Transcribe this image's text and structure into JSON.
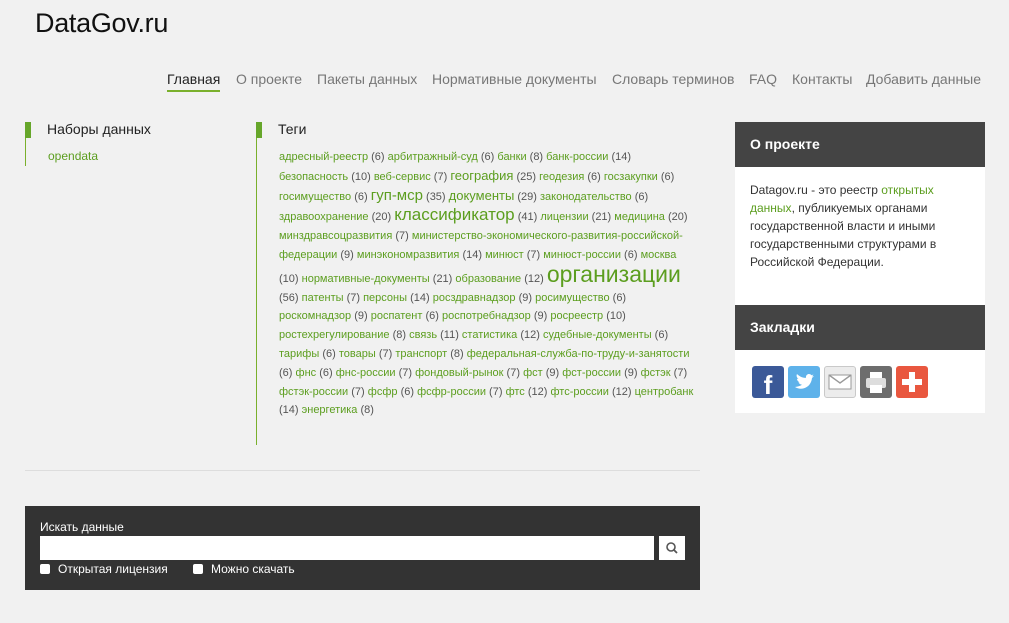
{
  "site": {
    "title": "DataGov.ru"
  },
  "nav": [
    "Главная",
    "О проекте",
    "Пакеты данных",
    "Нормативные документы",
    "Словарь терминов",
    "FAQ",
    "Контакты",
    "Добавить данные"
  ],
  "datasets": {
    "heading": "Наборы данных",
    "items": [
      "opendata"
    ]
  },
  "tags": {
    "heading": "Теги",
    "items": [
      {
        "name": "адресный-реестр",
        "count": "(6)"
      },
      {
        "name": "арбитражный-суд",
        "count": "(6)"
      },
      {
        "name": "банки",
        "count": "(8)"
      },
      {
        "name": "банк-россии",
        "count": "(14)"
      },
      {
        "name": "безопасность",
        "count": "(10)"
      },
      {
        "name": "веб-сервис",
        "count": "(7)"
      },
      {
        "name": "география",
        "count": "(25)"
      },
      {
        "name": "геодезия",
        "count": "(6)"
      },
      {
        "name": "госзакупки",
        "count": "(6)"
      },
      {
        "name": "госимущество",
        "count": "(6)"
      },
      {
        "name": "гуп-мср",
        "count": "(35)"
      },
      {
        "name": "документы",
        "count": "(29)"
      },
      {
        "name": "законодательство",
        "count": "(6)"
      },
      {
        "name": "здравоохранение",
        "count": "(20)"
      },
      {
        "name": "классификатор",
        "count": "(41)"
      },
      {
        "name": "лицензии",
        "count": "(21)"
      },
      {
        "name": "медицина",
        "count": "(20)"
      },
      {
        "name": "минздравсоцразвития",
        "count": "(7)"
      },
      {
        "name": "министерство-экономического-развития-российской-федерации",
        "count": "(9)"
      },
      {
        "name": "минэкономразвития",
        "count": "(14)"
      },
      {
        "name": "минюст",
        "count": "(7)"
      },
      {
        "name": "минюст-россии",
        "count": "(6)"
      },
      {
        "name": "москва",
        "count": "(10)"
      },
      {
        "name": "нормативные-документы",
        "count": "(21)"
      },
      {
        "name": "образование",
        "count": "(12)"
      },
      {
        "name": "организации",
        "count": "(56)"
      },
      {
        "name": "патенты",
        "count": "(7)"
      },
      {
        "name": "персоны",
        "count": "(14)"
      },
      {
        "name": "росздравнадзор",
        "count": "(9)"
      },
      {
        "name": "росимущество",
        "count": "(6)"
      },
      {
        "name": "роскомнадзор",
        "count": "(9)"
      },
      {
        "name": "роспатент",
        "count": "(6)"
      },
      {
        "name": "роспотребнадзор",
        "count": "(9)"
      },
      {
        "name": "росреестр",
        "count": "(10)"
      },
      {
        "name": "ростехрегулирование",
        "count": "(8)"
      },
      {
        "name": "связь",
        "count": "(11)"
      },
      {
        "name": "статистика",
        "count": "(12)"
      },
      {
        "name": "судебные-документы",
        "count": "(6)"
      },
      {
        "name": "тарифы",
        "count": "(6)"
      },
      {
        "name": "товары",
        "count": "(7)"
      },
      {
        "name": "транспорт",
        "count": "(8)"
      },
      {
        "name": "федеральная-служба-по-труду-и-занятости",
        "count": "(6)"
      },
      {
        "name": "фнс",
        "count": "(6)"
      },
      {
        "name": "фнс-россии",
        "count": "(7)"
      },
      {
        "name": "фондовый-рынок",
        "count": "(7)"
      },
      {
        "name": "фст",
        "count": "(9)"
      },
      {
        "name": "фст-россии",
        "count": "(9)"
      },
      {
        "name": "фстэк",
        "count": "(7)"
      },
      {
        "name": "фстэк-россии",
        "count": "(7)"
      },
      {
        "name": "фсфр",
        "count": "(6)"
      },
      {
        "name": "фсфр-россии",
        "count": "(7)"
      },
      {
        "name": "фтс",
        "count": "(12)"
      },
      {
        "name": "фтс-россии",
        "count": "(12)"
      },
      {
        "name": "центробанк",
        "count": "(14)"
      },
      {
        "name": "энергетика",
        "count": "(8)"
      }
    ]
  },
  "search": {
    "label": "Искать данные",
    "value": "",
    "option1": "Открытая лицензия",
    "option2": "Можно скачать"
  },
  "about": {
    "heading": "О проекте",
    "text_before": "Datagov.ru - это реестр ",
    "link": "открытых данных",
    "text_after": ", публикуемых органами государственной власти и иными государственными структурами в Российской Федерации."
  },
  "bookmarks": {
    "heading": "Закладки",
    "icons": [
      {
        "name": "facebook-icon",
        "color": "#3b5998"
      },
      {
        "name": "twitter-icon",
        "color": "#55acee"
      },
      {
        "name": "email-icon",
        "color": "#e6e6e6"
      },
      {
        "name": "print-icon",
        "color": "#666666"
      },
      {
        "name": "add-icon",
        "color": "#e9573f"
      }
    ]
  },
  "colors": {
    "accent": "#66a62a",
    "dark_panel": "#333333",
    "sidebar_head": "#444444"
  }
}
